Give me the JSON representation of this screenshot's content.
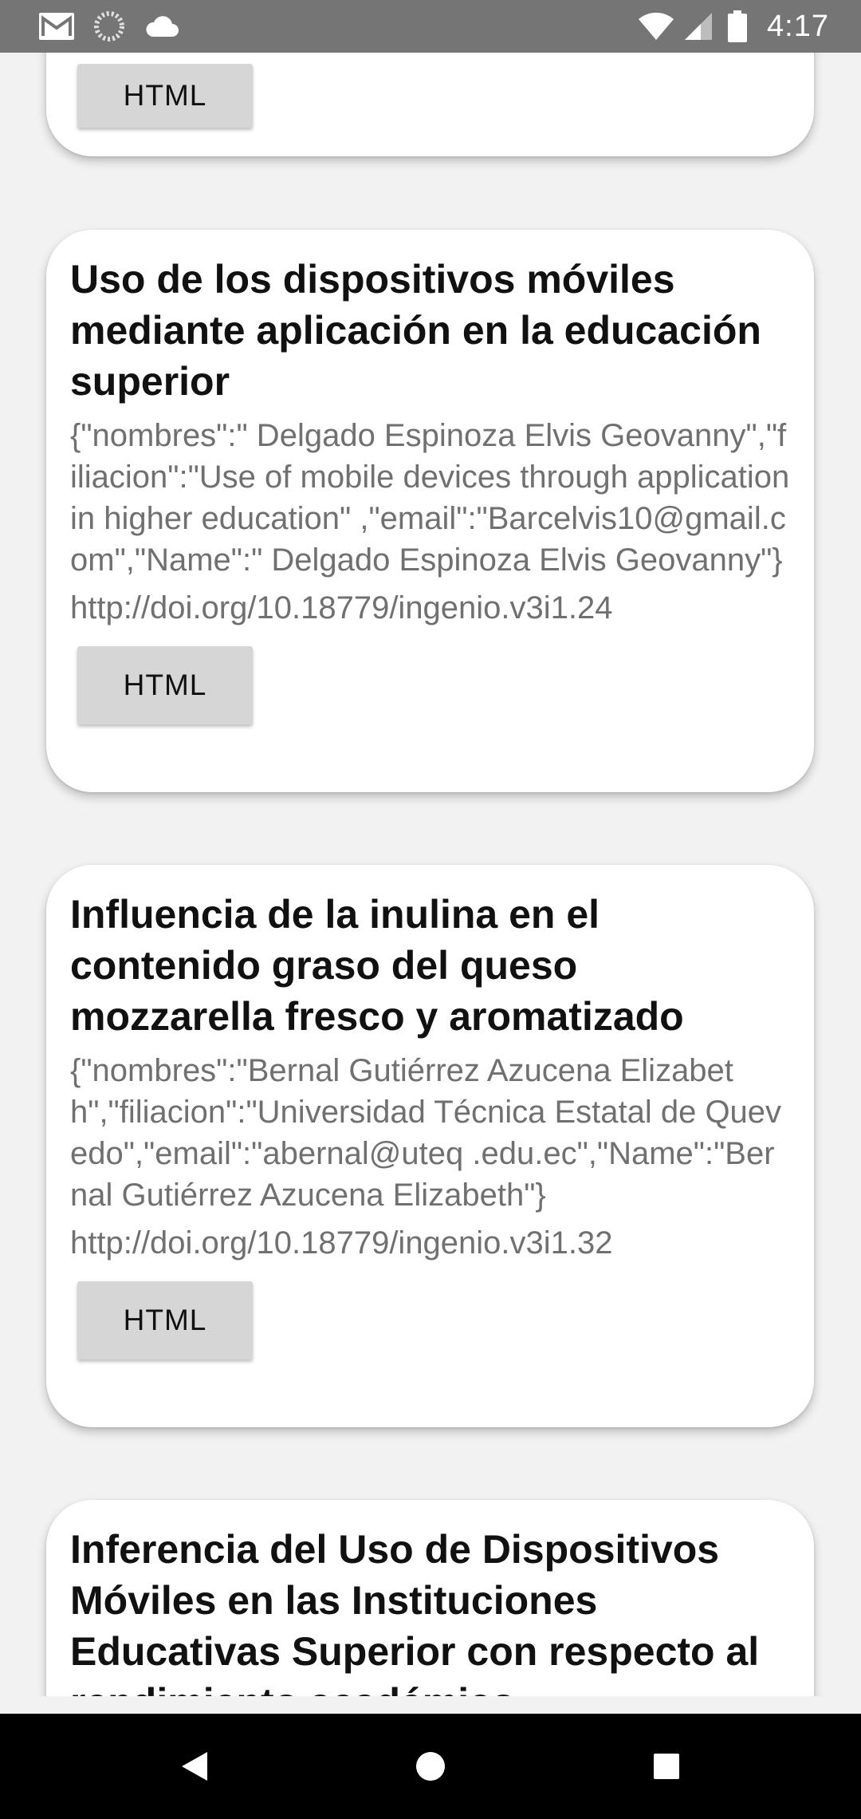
{
  "status_bar": {
    "time": "4:17",
    "left_icons": [
      "gmail-icon",
      "sync-icon",
      "cloud-icon"
    ],
    "right_icons": [
      "wifi-icon",
      "signal-icon",
      "battery-icon"
    ]
  },
  "articles": [
    {
      "title": "",
      "meta": "",
      "doi": "",
      "button_label": "HTML"
    },
    {
      "title": "Uso de los dispositivos móviles mediante aplicación en la educación superior",
      "meta": "{\"nombres\":\" Delgado Espinoza Elvis Geovanny\",\"filiacion\":\"Use of mobile devices through application in higher education\" ,\"email\":\"Barcelvis10@gmail.com\",\"Name\":\" Delgado Espinoza Elvis Geovanny\"}",
      "doi": "http://doi.org/10.18779/ingenio.v3i1.24",
      "button_label": "HTML"
    },
    {
      "title": "Influencia de la inulina en el contenido graso del queso mozzarella fresco y aromatizado",
      "meta": "{\"nombres\":\"Bernal  Gutiérrez Azucena Elizabeth\",\"filiacion\":\"Universidad Técnica Estatal de Quevedo\",\"email\":\"abernal@uteq .edu.ec\",\"Name\":\"Bernal  Gutiérrez Azucena Elizabeth\"}",
      "doi": "http://doi.org/10.18779/ingenio.v3i1.32",
      "button_label": "HTML"
    },
    {
      "title": "Inferencia del Uso de Dispositivos Móviles en las Instituciones Educativas Superior con respecto al rendimiento académico",
      "meta": "",
      "doi": "",
      "button_label": ""
    }
  ],
  "nav_bar": {
    "buttons": [
      "back-icon",
      "home-icon",
      "recents-icon"
    ]
  }
}
